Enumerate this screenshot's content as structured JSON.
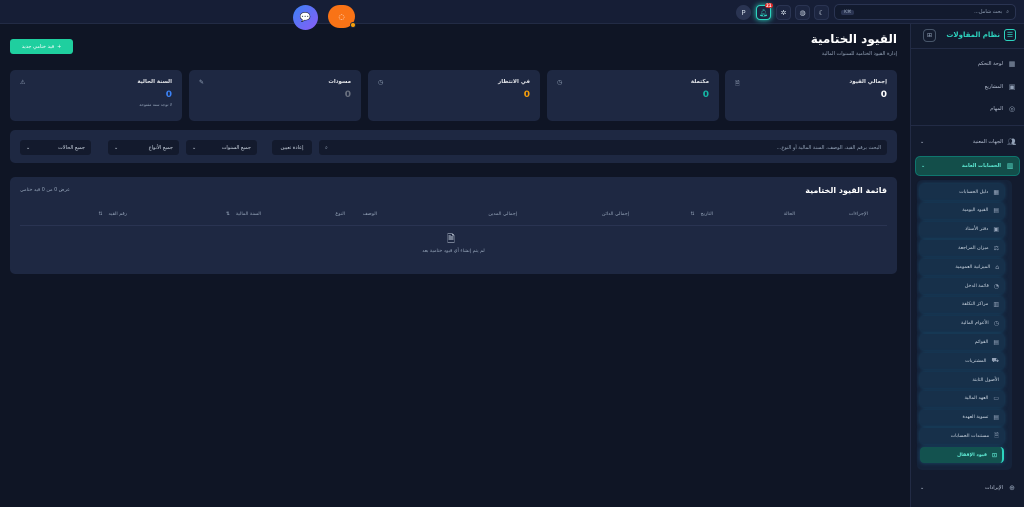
{
  "header": {
    "search_placeholder": "بحث شامل...",
    "shortcut": "⌘K",
    "notification_count": "21",
    "avatar_letter": "P"
  },
  "app": {
    "name": "نظام المقاولات"
  },
  "sidebar": {
    "top": [
      {
        "label": "لوحة التحكم",
        "icon": "dashboard-icon"
      },
      {
        "label": "المشاريع",
        "icon": "briefcase-icon"
      },
      {
        "label": "المهام",
        "icon": "check-circle-icon"
      }
    ],
    "groups": [
      {
        "label": "الجهات المعنية",
        "icon": "users-icon"
      },
      {
        "label": "الحسابات العامة",
        "icon": "chart-icon"
      }
    ],
    "sub": [
      "دليل الحسابات",
      "القيود اليومية",
      "دفتر الأستاذ",
      "ميزان المراجعة",
      "الميزانية العمومية",
      "قائمة الدخل",
      "مراكز التكلفة",
      "الأعوام المالية",
      "القوائم",
      "المشتريات",
      "الأصول الثابتة",
      "العهد المالية",
      "تسوية العهدة",
      "مستندات الحسابات",
      "قيود الإقفال"
    ],
    "bottom": {
      "label": "الإيرادات"
    }
  },
  "page": {
    "title": "القيود الختامية",
    "subtitle": "إدارة القيود الختامية للسنوات المالية",
    "new_button": "قيد ختامي جديد"
  },
  "stats": [
    {
      "label": "إجمالي القيود",
      "value": "0",
      "color": "#ffffff"
    },
    {
      "label": "مكتملة",
      "value": "0",
      "color": "#14b8a6"
    },
    {
      "label": "في الانتظار",
      "value": "0",
      "color": "#f59e0b"
    },
    {
      "label": "مسودات",
      "value": "0",
      "color": "#6b7280"
    },
    {
      "label": "السنة الحالية",
      "value": "0",
      "color": "#3b82f6",
      "note": "لا توجد سنة مفتوحة"
    }
  ],
  "filters": {
    "search_placeholder": "البحث برقم القيد، الوصف، السنة المالية أو النوع...",
    "reset": "إعادة تعيين",
    "years": "جميع السنوات",
    "types": "جميع الأنواع",
    "statuses": "جميع الحالات"
  },
  "table": {
    "title": "قائمة القيود الختامية",
    "count": "عرض 0 من 0 قيد ختامي",
    "columns": [
      "رقم القيد",
      "السنة المالية",
      "النوع",
      "الوصف",
      "إجمالي المدين",
      "إجمالي الدائن",
      "التاريخ",
      "الحالة",
      "الإجراءات"
    ],
    "empty": "لم يتم إنشاء أي قيود ختامية بعد"
  }
}
